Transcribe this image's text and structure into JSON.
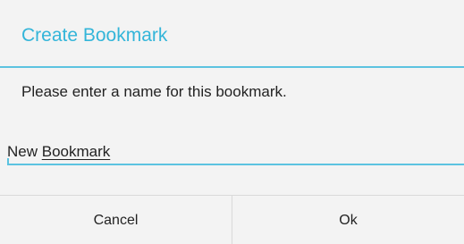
{
  "dialog": {
    "title": "Create Bookmark",
    "message": "Please enter a name for this bookmark.",
    "input": {
      "value_prefix": "New ",
      "value_underlined": "Bookmark"
    },
    "buttons": {
      "cancel_label": "Cancel",
      "ok_label": "Ok"
    }
  },
  "colors": {
    "accent": "#33b5d9",
    "background": "#f3f3f3",
    "text": "#222222"
  }
}
